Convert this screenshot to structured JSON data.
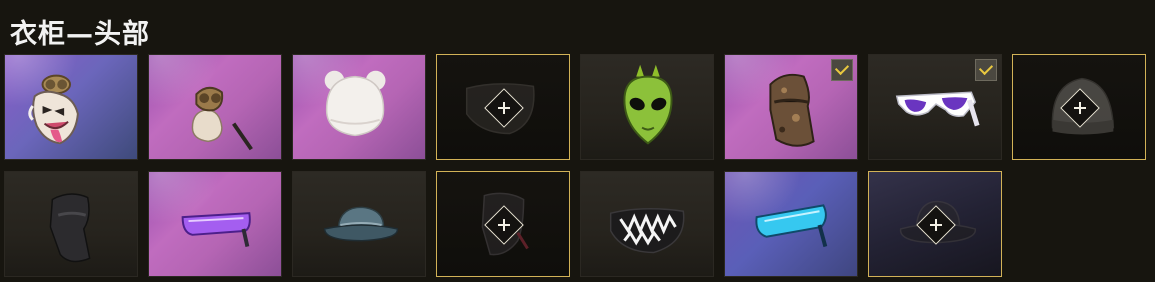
{
  "header": {
    "title": "衣柜—头部"
  },
  "colors": {
    "slot_border_accent": "#d2b257",
    "check_mark": "#e9c83f",
    "background": "#17150f"
  },
  "grid": {
    "items": [
      {
        "icon": "jester-mask-icon",
        "equipped": false,
        "addable": false
      },
      {
        "icon": "goggles-bust-icon",
        "equipped": false,
        "addable": false
      },
      {
        "icon": "white-bear-beanie-icon",
        "equipped": false,
        "addable": false
      },
      {
        "icon": "black-face-mask-icon",
        "equipped": false,
        "addable": true
      },
      {
        "icon": "green-alien-mask-icon",
        "equipped": false,
        "addable": false
      },
      {
        "icon": "camo-face-mask-icon",
        "equipped": true,
        "addable": false
      },
      {
        "icon": "purple-sunglasses-icon",
        "equipped": true,
        "addable": false
      },
      {
        "icon": "gray-beanie-icon",
        "equipped": false,
        "addable": true
      },
      {
        "icon": "black-balaclava-icon",
        "equipped": false,
        "addable": false
      },
      {
        "icon": "purple-visor-glasses-icon",
        "equipped": false,
        "addable": false
      },
      {
        "icon": "blue-bucket-hat-icon",
        "equipped": false,
        "addable": false
      },
      {
        "icon": "dark-face-mask-icon",
        "equipped": false,
        "addable": true
      },
      {
        "icon": "shark-teeth-mask-icon",
        "equipped": false,
        "addable": false
      },
      {
        "icon": "blue-visor-glasses-icon",
        "equipped": false,
        "addable": false
      },
      {
        "icon": "black-bucket-hat-icon",
        "equipped": false,
        "addable": true
      }
    ]
  }
}
